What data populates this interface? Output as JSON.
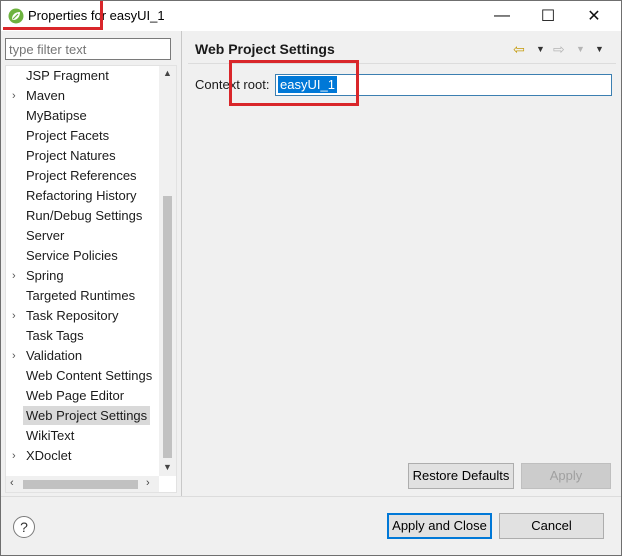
{
  "window": {
    "title": "Properties for easyUI_1",
    "minimize_glyph": "—",
    "maximize_glyph": "☐",
    "close_glyph": "✕",
    "app_icon": "spring-leaf-icon",
    "accent_color": "#d9262a"
  },
  "sidebar": {
    "filter_placeholder": "type filter text",
    "items": [
      {
        "label": "JSP Fragment",
        "expandable": false
      },
      {
        "label": "Maven",
        "expandable": true
      },
      {
        "label": "MyBatipse",
        "expandable": false
      },
      {
        "label": "Project Facets",
        "expandable": false
      },
      {
        "label": "Project Natures",
        "expandable": false
      },
      {
        "label": "Project References",
        "expandable": false
      },
      {
        "label": "Refactoring History",
        "expandable": false
      },
      {
        "label": "Run/Debug Settings",
        "expandable": false
      },
      {
        "label": "Server",
        "expandable": false
      },
      {
        "label": "Service Policies",
        "expandable": false
      },
      {
        "label": "Spring",
        "expandable": true
      },
      {
        "label": "Targeted Runtimes",
        "expandable": false
      },
      {
        "label": "Task Repository",
        "expandable": true
      },
      {
        "label": "Task Tags",
        "expandable": false
      },
      {
        "label": "Validation",
        "expandable": true
      },
      {
        "label": "Web Content Settings",
        "expandable": false
      },
      {
        "label": "Web Page Editor",
        "expandable": false
      },
      {
        "label": "Web Project Settings",
        "expandable": false,
        "selected": true
      },
      {
        "label": "WikiText",
        "expandable": false
      },
      {
        "label": "XDoclet",
        "expandable": true
      }
    ]
  },
  "main": {
    "title": "Web Project Settings",
    "context_root_label": "Context root:",
    "context_root_value": "easyUI_1",
    "restore_defaults_label": "Restore Defaults",
    "apply_label": "Apply"
  },
  "footer": {
    "help_glyph": "?",
    "apply_close_label": "Apply and Close",
    "cancel_label": "Cancel"
  }
}
